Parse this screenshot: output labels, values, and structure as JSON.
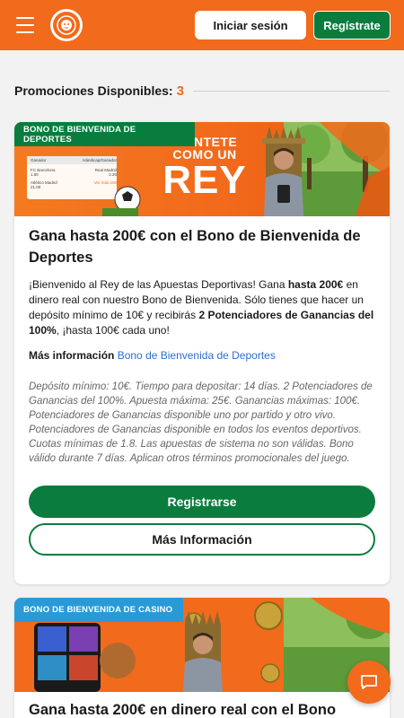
{
  "header": {
    "login_label": "Iniciar sesión",
    "register_label": "Regístrate",
    "brand_color": "#f26a1b",
    "accent_green": "#0a7d3e"
  },
  "promotions": {
    "label": "Promociones Disponibles:",
    "count": "3"
  },
  "cards": [
    {
      "badge": "BONO DE BIENVENIDA DE DEPORTES",
      "banner_line1": "SIÉNTETE",
      "banner_line2": "COMO UN",
      "banner_line3": "REY",
      "mock_table": {
        "tab1": "Ganador",
        "tab2": "Hándicap/Ganador",
        "rows": [
          {
            "home": "FC Barcelona",
            "home_odd": "1.80",
            "away": "Real Madrid",
            "away_odd": "2.20"
          },
          {
            "home": "Atlético Madrid",
            "home_odd": "21.00",
            "away": "Ver más 100",
            "away_odd": ""
          }
        ]
      },
      "title": "Gana hasta 200€ con el Bono de Bienvenida de Deportes",
      "desc_part1": "¡Bienvenido al Rey de las Apuestas Deportivas! Gana ",
      "desc_bold1": "hasta 200€",
      "desc_part2": " en dinero real con nuestro Bono de Bienvenida. Sólo tienes que hacer un depósito mínimo de 10€ y recibirás ",
      "desc_bold2": "2 Potenciadores de Ganancias del 100%",
      "desc_part3": ", ¡hasta 100€ cada uno!",
      "more_info_label": "Más información",
      "more_info_link": "Bono de Bienvenida de Deportes",
      "terms": "Depósito mínimo: 10€. Tiempo para depositar: 14 días. 2 Potenciadores de Ganancias del 100%. Apuesta máxima: 25€. Ganancias máximas: 100€. Potenciadores de Ganancias disponible uno por partido y otro vivo. Potenciadores de Ganancias disponible en todos los eventos deportivos. Cuotas mínimas de 1.8. Las apuestas de sistema no son válidas. Bono válido durante 7 días. Aplican otros términos promocionales del juego.",
      "primary_button": "Registrarse",
      "secondary_button": "Más Información"
    },
    {
      "badge": "BONO DE BIENVENIDA DE CASINO",
      "title": "Gana hasta 200€ en dinero real con el Bono"
    }
  ]
}
